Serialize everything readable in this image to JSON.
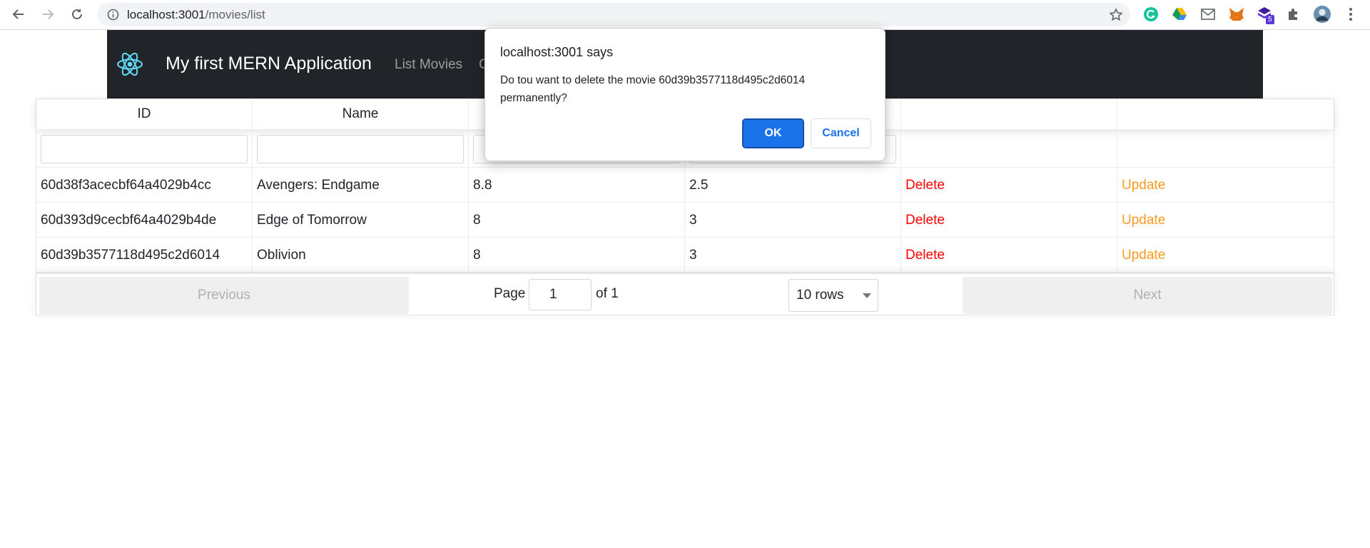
{
  "browser": {
    "url_host": "localhost:3001",
    "url_path": "/movies/list",
    "extension_badge": "5"
  },
  "app": {
    "brand": "My first MERN Application",
    "nav_links": [
      "List Movies",
      "C"
    ]
  },
  "table": {
    "columns": [
      "ID",
      "Name",
      "",
      "",
      "",
      ""
    ],
    "rows": [
      {
        "id": "60d38f3acecbf64a4029b4cc",
        "name": "Avengers: Endgame",
        "rating": "8.8",
        "time": "2.5",
        "delete": "Delete",
        "update": "Update"
      },
      {
        "id": "60d393d9cecbf64a4029b4de",
        "name": "Edge of Tomorrow",
        "rating": "8",
        "time": "3",
        "delete": "Delete",
        "update": "Update"
      },
      {
        "id": "60d39b3577118d495c2d6014",
        "name": "Oblivion",
        "rating": "8",
        "time": "3",
        "delete": "Delete",
        "update": "Update"
      }
    ]
  },
  "pagination": {
    "previous": "Previous",
    "page_label": "Page",
    "page_value": "1",
    "of_label": "of 1",
    "rows_select": "10 rows",
    "next": "Next"
  },
  "dialog": {
    "title": "localhost:3001 says",
    "message": "Do tou want to delete the movie 60d39b3577118d495c2d6014 permanently?",
    "ok": "OK",
    "cancel": "Cancel"
  },
  "colors": {
    "nav_bg": "#212529",
    "delete": "#ff0000",
    "update": "#ff9a1f",
    "ok_button": "#1a73e8"
  }
}
